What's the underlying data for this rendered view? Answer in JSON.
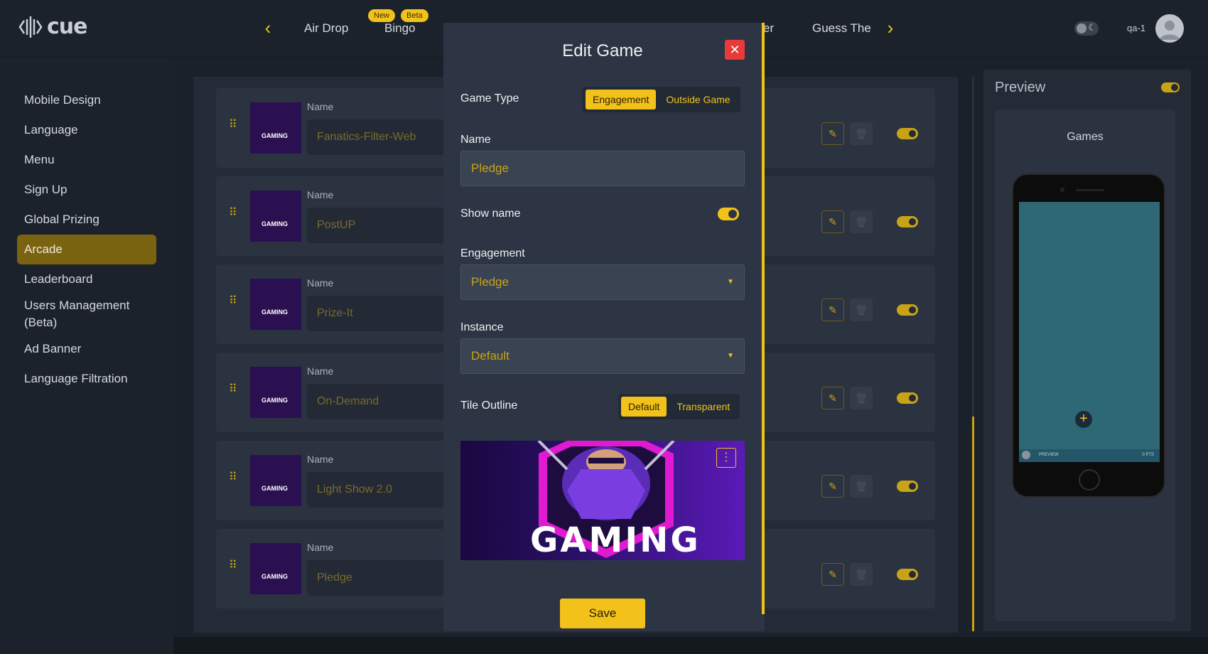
{
  "app": {
    "logo_text": "cue"
  },
  "topnav": {
    "tabs": [
      {
        "label": "Air Drop"
      },
      {
        "label": "Bingo",
        "badges": [
          "New",
          "Beta"
        ]
      },
      {
        "label": "er"
      },
      {
        "label": "Guess The"
      }
    ]
  },
  "user": {
    "name": "qa-1"
  },
  "sidebar": {
    "items": [
      {
        "label": "Mobile Design",
        "active": false
      },
      {
        "label": "Language",
        "active": false
      },
      {
        "label": "Menu",
        "active": false
      },
      {
        "label": "Sign Up",
        "active": false
      },
      {
        "label": "Global Prizing",
        "active": false
      },
      {
        "label": "Arcade",
        "active": true
      },
      {
        "label": "Leaderboard",
        "active": false
      },
      {
        "label": "Users Management (Beta)",
        "active": false
      },
      {
        "label": "Ad Banner",
        "active": false
      },
      {
        "label": "Language Filtration",
        "active": false
      }
    ]
  },
  "games_list": {
    "field_label": "Name",
    "thumb_text": "GAMING",
    "rows": [
      {
        "name": "Fanatics-Filter-Web",
        "enabled": true
      },
      {
        "name": "PostUP",
        "enabled": true
      },
      {
        "name": "Prize-It",
        "enabled": true
      },
      {
        "name": "On-Demand",
        "enabled": true
      },
      {
        "name": "Light Show 2.0",
        "enabled": true
      },
      {
        "name": "Pledge",
        "enabled": true
      }
    ]
  },
  "preview": {
    "title": "Preview",
    "subtitle": "Games",
    "phone_left_text": "PREVIEW",
    "phone_right_text": "0 PTS"
  },
  "modal": {
    "title": "Edit Game",
    "game_type": {
      "label": "Game Type",
      "options": [
        "Engagement",
        "Outside Game"
      ],
      "selected": "Engagement"
    },
    "name": {
      "label": "Name",
      "value": "Pledge"
    },
    "show_name": {
      "label": "Show name",
      "enabled": true
    },
    "engagement": {
      "label": "Engagement",
      "value": "Pledge"
    },
    "instance": {
      "label": "Instance",
      "value": "Default"
    },
    "tile_outline": {
      "label": "Tile Outline",
      "options": [
        "Default",
        "Transparent"
      ],
      "selected": "Default"
    },
    "banner_text": "GAMING",
    "save_label": "Save"
  },
  "colors": {
    "accent": "#f2c21b",
    "background": "#1b212b",
    "modal_bg": "#2d3544",
    "close": "#e83a3a"
  }
}
